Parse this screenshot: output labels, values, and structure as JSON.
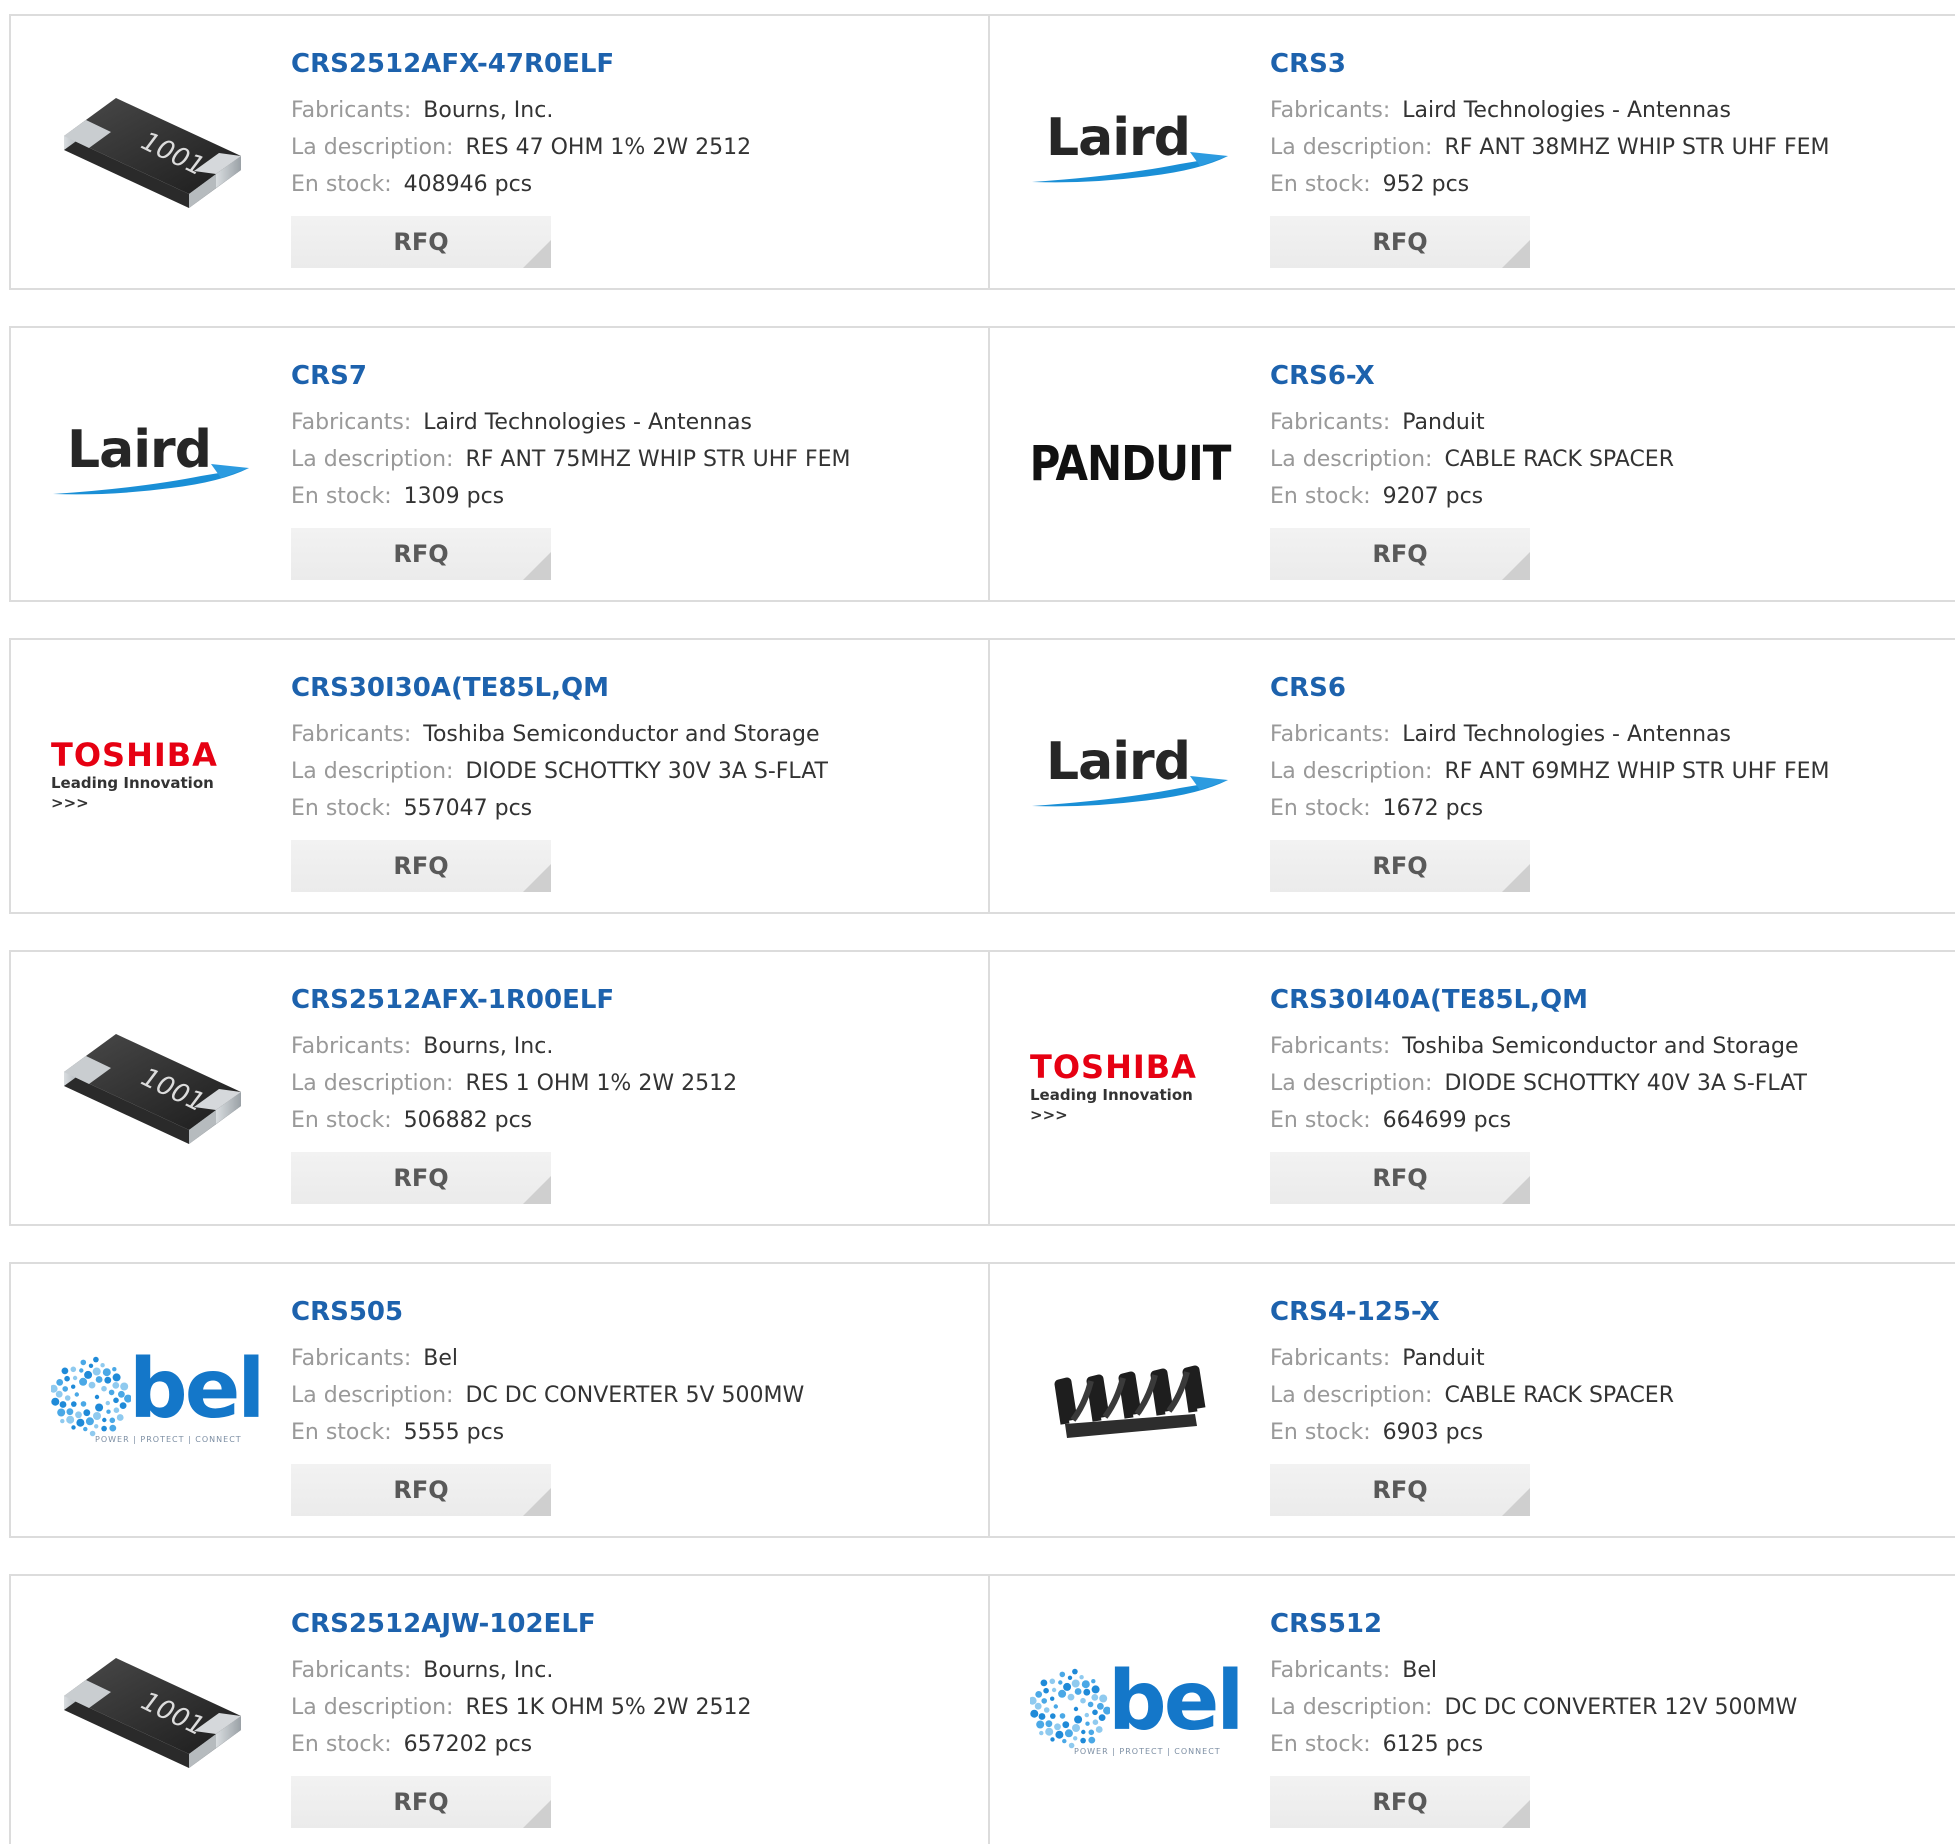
{
  "labels": {
    "manufacturer": "Fabricants:",
    "description": "La description:",
    "stock": "En stock:",
    "rfq": "RFQ"
  },
  "products": [
    {
      "part": "CRS2512AFX-47R0ELF",
      "manufacturer": "Bourns, Inc.",
      "description": "RES 47 OHM 1% 2W 2512",
      "stock": "408946 pcs",
      "image": "resistor-chip-image"
    },
    {
      "part": "CRS3",
      "manufacturer": "Laird Technologies - Antennas",
      "description": "RF ANT 38MHZ WHIP STR UHF FEM",
      "stock": "952 pcs",
      "image": "laird-logo"
    },
    {
      "part": "CRS7",
      "manufacturer": "Laird Technologies - Antennas",
      "description": "RF ANT 75MHZ WHIP STR UHF FEM",
      "stock": "1309 pcs",
      "image": "laird-logo"
    },
    {
      "part": "CRS6-X",
      "manufacturer": "Panduit",
      "description": "CABLE RACK SPACER",
      "stock": "9207 pcs",
      "image": "panduit-logo"
    },
    {
      "part": "CRS30I30A(TE85L,QM",
      "manufacturer": "Toshiba Semiconductor and Storage",
      "description": "DIODE SCHOTTKY 30V 3A S-FLAT",
      "stock": "557047 pcs",
      "image": "toshiba-logo"
    },
    {
      "part": "CRS6",
      "manufacturer": "Laird Technologies - Antennas",
      "description": "RF ANT 69MHZ WHIP STR UHF FEM",
      "stock": "1672 pcs",
      "image": "laird-logo"
    },
    {
      "part": "CRS2512AFX-1R00ELF",
      "manufacturer": "Bourns, Inc.",
      "description": "RES 1 OHM 1% 2W 2512",
      "stock": "506882 pcs",
      "image": "resistor-chip-image"
    },
    {
      "part": "CRS30I40A(TE85L,QM",
      "manufacturer": "Toshiba Semiconductor and Storage",
      "description": "DIODE SCHOTTKY 40V 3A S-FLAT",
      "stock": "664699 pcs",
      "image": "toshiba-logo"
    },
    {
      "part": "CRS505",
      "manufacturer": "Bel",
      "description": "DC DC CONVERTER 5V 500MW",
      "stock": "5555 pcs",
      "image": "bel-logo"
    },
    {
      "part": "CRS4-125-X",
      "manufacturer": "Panduit",
      "description": "CABLE RACK SPACER",
      "stock": "6903 pcs",
      "image": "cable-rack-spacer-image"
    },
    {
      "part": "CRS2512AJW-102ELF",
      "manufacturer": "Bourns, Inc.",
      "description": "RES 1K OHM 5% 2W 2512",
      "stock": "657202 pcs",
      "image": "resistor-chip-image"
    },
    {
      "part": "CRS512",
      "manufacturer": "Bel",
      "description": "DC DC CONVERTER 12V 500MW",
      "stock": "6125 pcs",
      "image": "bel-logo"
    }
  ],
  "logo_text": {
    "resistor_marking": "1001",
    "laird": "Laird",
    "panduit": "PANDUIT",
    "toshiba": "TOSHIBA",
    "toshiba_tagline": "Leading Innovation >>>",
    "bel": "bel",
    "bel_tagline": "POWER | PROTECT | CONNECT"
  },
  "colors": {
    "part_link": "#1d62ad",
    "label": "#999999",
    "value": "#333333",
    "rfq_bg": "#efefef",
    "border": "#dcdcdc",
    "toshiba_red": "#e60012",
    "laird_swoosh": "#1a8fd6",
    "bel_blue": "#1477c9"
  }
}
